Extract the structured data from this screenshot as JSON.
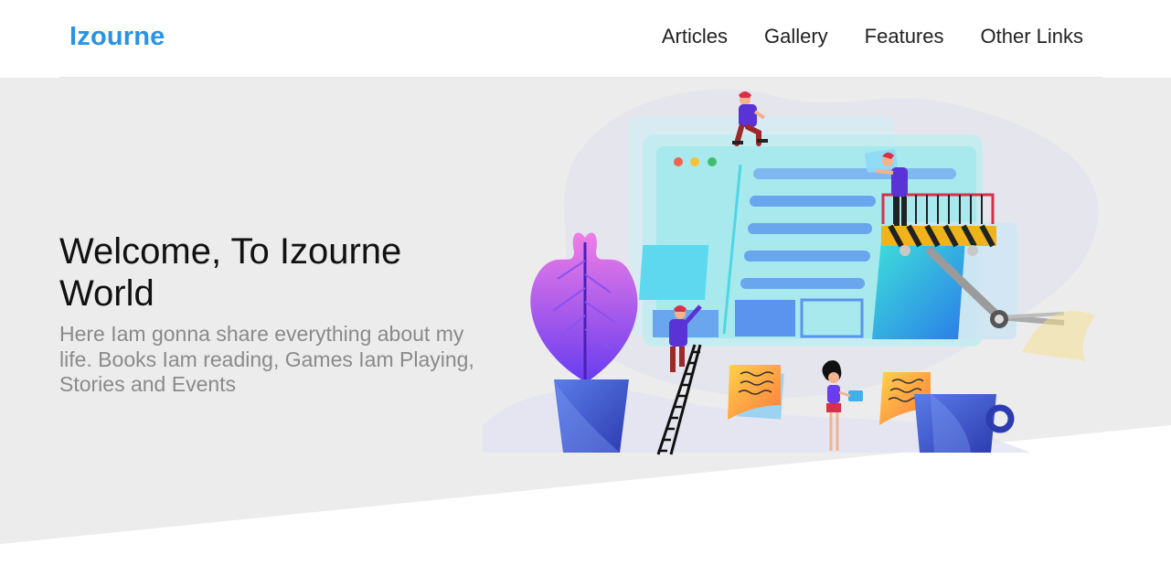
{
  "header": {
    "brand": "Izourne",
    "nav": [
      {
        "label": "Articles"
      },
      {
        "label": "Gallery"
      },
      {
        "label": "Features"
      },
      {
        "label": "Other Links"
      }
    ]
  },
  "hero": {
    "title": "Welcome, To Izourne World",
    "subtitle": "Here Iam gonna share everything about my life. Books Iam reading, Games Iam Playing, Stories and Events"
  },
  "colors": {
    "brand": "#2a93e4",
    "hero_background": "#ececec",
    "nav_text": "#222222",
    "subtitle_text": "#8a8a8a"
  },
  "illustration": {
    "icon": "web-development-illustration"
  }
}
